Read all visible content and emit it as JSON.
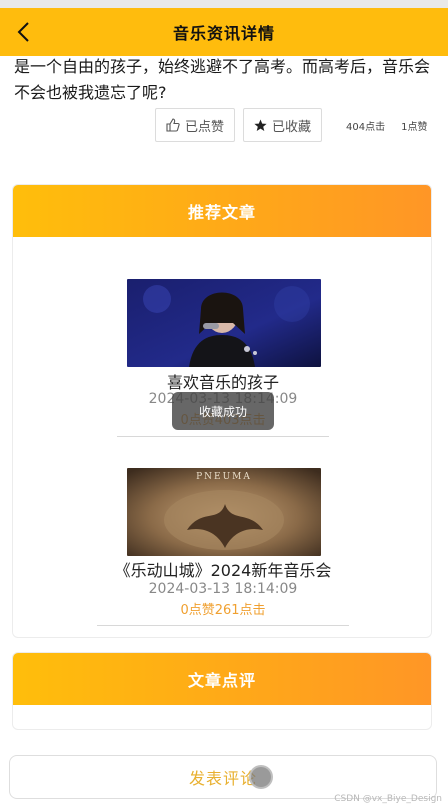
{
  "header": {
    "title": "音乐资讯详情",
    "back_icon": "chevron-left-icon"
  },
  "article": {
    "intro_text": "是一个自由的孩子，始终逃避不了高考。而高考后，音乐会不会也被我遗忘了呢?",
    "like_label": "已点赞",
    "favorite_label": "已收藏",
    "clicks_text": "404点击",
    "comments_text": "1点赞"
  },
  "recommended": {
    "section_title": "推荐文章",
    "items": [
      {
        "title": "喜欢音乐的孩子",
        "date": "2024-03-13 18:14:09",
        "stats": "0点赞403点击"
      },
      {
        "title": "《乐动山城》2024新年音乐会",
        "date": "2024-03-13 18:14:09",
        "stats": "0点赞261点击",
        "image_text": "PNEUMA"
      }
    ]
  },
  "toast": {
    "text": "收藏成功"
  },
  "comments": {
    "section_title": "文章点评"
  },
  "footer": {
    "post_comment_label": "发表评论"
  },
  "watermark": "CSDN @vx_Biye_Design",
  "colors": {
    "brand": "#ffbc0d",
    "stats_orange": "#f0a030",
    "accent_gradient_end": "#ff9626"
  }
}
